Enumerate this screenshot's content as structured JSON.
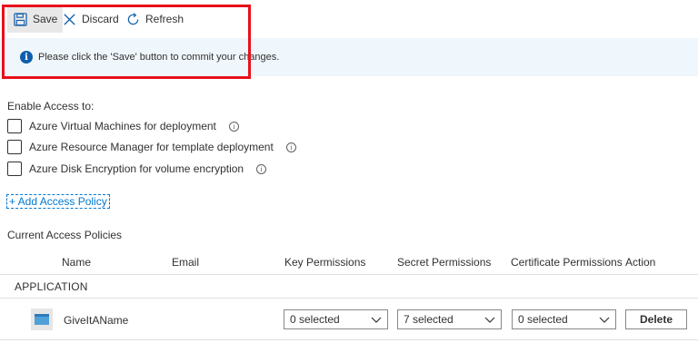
{
  "toolbar": {
    "save_label": "Save",
    "discard_label": "Discard",
    "refresh_label": "Refresh"
  },
  "info_bar": {
    "message": "Please click the 'Save' button to commit your changes."
  },
  "enable_access": {
    "heading": "Enable Access to:",
    "options": [
      {
        "label": "Azure Virtual Machines for deployment",
        "checked": false
      },
      {
        "label": "Azure Resource Manager for template deployment",
        "checked": false
      },
      {
        "label": "Azure Disk Encryption for volume encryption",
        "checked": false
      }
    ]
  },
  "add_policy_label": "+ Add Access Policy",
  "current_policies": {
    "heading": "Current Access Policies",
    "columns": [
      "Name",
      "Email",
      "Key Permissions",
      "Secret Permissions",
      "Certificate Permissions",
      "Action"
    ],
    "group_label": "APPLICATION",
    "rows": [
      {
        "name": "GiveItAName",
        "email": "",
        "key_permissions": "0 selected",
        "secret_permissions": "7 selected",
        "certificate_permissions": "0 selected",
        "action": "Delete"
      }
    ]
  },
  "icons": {
    "save": "save-icon",
    "discard": "close-icon",
    "refresh": "refresh-icon",
    "info": "info-icon"
  },
  "colors": {
    "accent": "#0078d4",
    "info_bg": "#eff6fc",
    "highlight": "#e8101c"
  }
}
